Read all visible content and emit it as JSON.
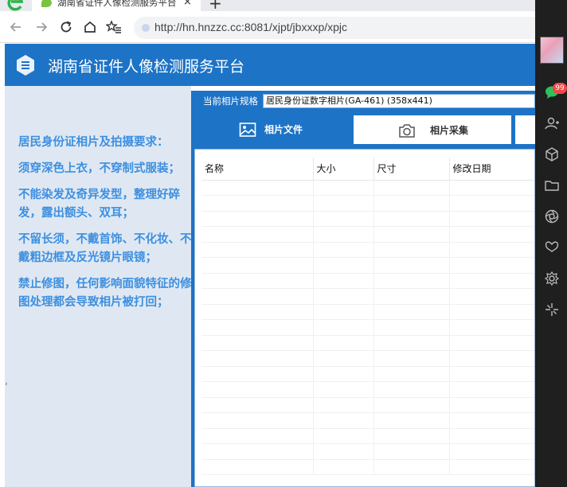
{
  "browser": {
    "tab_title": "湖南省证件人像检测服务平台",
    "tab_close": "×",
    "new_tab": "+",
    "url": "http://hn.hnzzc.cc:8081/xjpt/jbxxxp/xpjc",
    "sidebar": {
      "badge_count": "99",
      "icons": [
        "avatar",
        "chat-icon",
        "contacts-icon",
        "cube-icon",
        "folder-icon",
        "aperture-icon",
        "butterfly-icon",
        "gear-flower-icon",
        "sparkle-icon"
      ]
    }
  },
  "header": {
    "title": "湖南省证件人像检测服务平台"
  },
  "requirements": {
    "paragraphs": [
      [
        "居民身份证相片及拍摄要求："
      ],
      [
        "须穿深色上衣，不穿制式服装；"
      ],
      [
        "不能染发及奇异发型，整理好碎",
        "发，露出额头、双耳；"
      ],
      [
        "不留长须，不戴首饰、不化妆、不",
        "戴粗边框及反光镜片眼镜；"
      ],
      [
        "禁止修图，任何影响面貌特征的修",
        "图处理都会导致相片被打回；"
      ]
    ]
  },
  "spec": {
    "label": "当前相片规格",
    "selected": "居民身份证数字相片(GA-461) (358x441)"
  },
  "tabs": {
    "photo_file": "相片文件",
    "photo_capture": "相片采集"
  },
  "file_table": {
    "columns": [
      "名称",
      "大小",
      "尺寸",
      "修改日期"
    ],
    "empty_rows": 19
  },
  "colors": {
    "brand_blue": "#1d73c6",
    "requirement_text": "#3d8fe0",
    "left_panel_bg": "#dfe8f2",
    "badge_red": "#f04848"
  }
}
